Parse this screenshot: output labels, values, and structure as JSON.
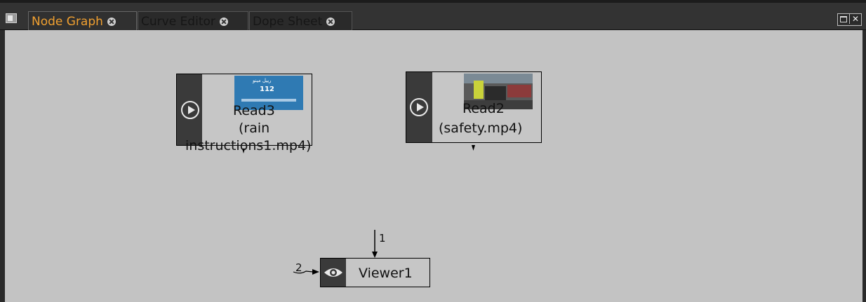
{
  "tabs": [
    {
      "label": "Node Graph",
      "active": true
    },
    {
      "label": "Curve Editor",
      "active": false
    },
    {
      "label": "Dope Sheet",
      "active": false
    }
  ],
  "nodes": {
    "read3": {
      "name": "Read3",
      "file_line1": "(rain",
      "file_line2": "instructions1.mp4)"
    },
    "read2": {
      "name": "Read2",
      "file": "(safety.mp4)"
    },
    "viewer1": {
      "name": "Viewer1",
      "input1_label": "1",
      "input2_label": "2"
    }
  },
  "thumb_read3": {
    "header": "رييل مينو",
    "number": "112"
  },
  "colors": {
    "accent": "#f0a030",
    "canvas": "#c3c3c3",
    "node_side": "#3a3a3a"
  }
}
